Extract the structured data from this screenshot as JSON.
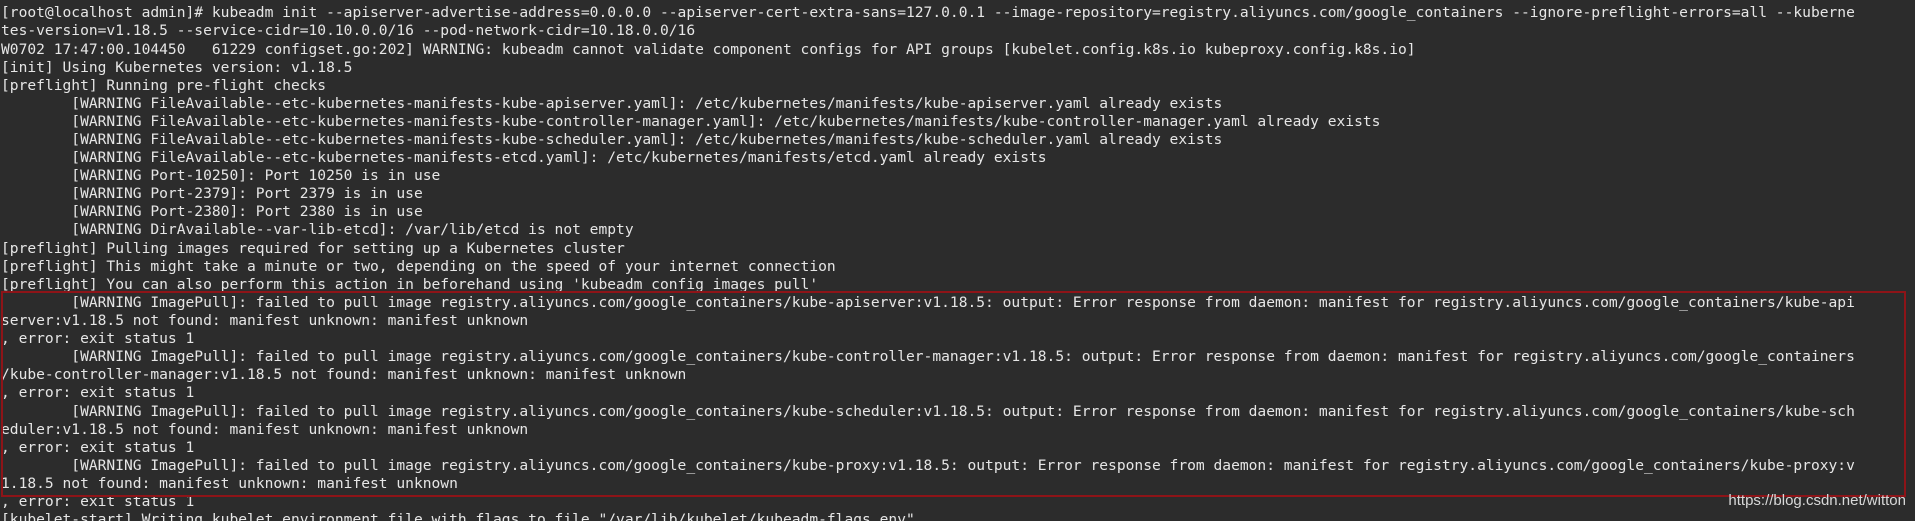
{
  "terminal": {
    "lines": [
      "[root@localhost admin]# kubeadm init --apiserver-advertise-address=0.0.0.0 --apiserver-cert-extra-sans=127.0.0.1 --image-repository=registry.aliyuncs.com/google_containers --ignore-preflight-errors=all --kuberne",
      "tes-version=v1.18.5 --service-cidr=10.10.0.0/16 --pod-network-cidr=10.18.0.0/16",
      "W0702 17:47:00.104450   61229 configset.go:202] WARNING: kubeadm cannot validate component configs for API groups [kubelet.config.k8s.io kubeproxy.config.k8s.io]",
      "[init] Using Kubernetes version: v1.18.5",
      "[preflight] Running pre-flight checks",
      "        [WARNING FileAvailable--etc-kubernetes-manifests-kube-apiserver.yaml]: /etc/kubernetes/manifests/kube-apiserver.yaml already exists",
      "        [WARNING FileAvailable--etc-kubernetes-manifests-kube-controller-manager.yaml]: /etc/kubernetes/manifests/kube-controller-manager.yaml already exists",
      "        [WARNING FileAvailable--etc-kubernetes-manifests-kube-scheduler.yaml]: /etc/kubernetes/manifests/kube-scheduler.yaml already exists",
      "        [WARNING FileAvailable--etc-kubernetes-manifests-etcd.yaml]: /etc/kubernetes/manifests/etcd.yaml already exists",
      "        [WARNING Port-10250]: Port 10250 is in use",
      "        [WARNING Port-2379]: Port 2379 is in use",
      "        [WARNING Port-2380]: Port 2380 is in use",
      "        [WARNING DirAvailable--var-lib-etcd]: /var/lib/etcd is not empty",
      "[preflight] Pulling images required for setting up a Kubernetes cluster",
      "[preflight] This might take a minute or two, depending on the speed of your internet connection",
      "[preflight] You can also perform this action in beforehand using 'kubeadm config images pull'",
      "        [WARNING ImagePull]: failed to pull image registry.aliyuncs.com/google_containers/kube-apiserver:v1.18.5: output: Error response from daemon: manifest for registry.aliyuncs.com/google_containers/kube-api",
      "server:v1.18.5 not found: manifest unknown: manifest unknown",
      ", error: exit status 1",
      "        [WARNING ImagePull]: failed to pull image registry.aliyuncs.com/google_containers/kube-controller-manager:v1.18.5: output: Error response from daemon: manifest for registry.aliyuncs.com/google_containers",
      "/kube-controller-manager:v1.18.5 not found: manifest unknown: manifest unknown",
      ", error: exit status 1",
      "        [WARNING ImagePull]: failed to pull image registry.aliyuncs.com/google_containers/kube-scheduler:v1.18.5: output: Error response from daemon: manifest for registry.aliyuncs.com/google_containers/kube-sch",
      "eduler:v1.18.5 not found: manifest unknown: manifest unknown",
      ", error: exit status 1",
      "        [WARNING ImagePull]: failed to pull image registry.aliyuncs.com/google_containers/kube-proxy:v1.18.5: output: Error response from daemon: manifest for registry.aliyuncs.com/google_containers/kube-proxy:v",
      "1.18.5 not found: manifest unknown: manifest unknown",
      ", error: exit status 1",
      "[kubelet-start] Writing kubelet environment file with flags to file \"/var/lib/kubelet/kubeadm-flags.env\""
    ]
  },
  "watermark": "https://blog.csdn.net/witton",
  "colors": {
    "background": "#2c2c2c",
    "text": "#e6e6e6",
    "highlight_border": "#8e1418"
  }
}
